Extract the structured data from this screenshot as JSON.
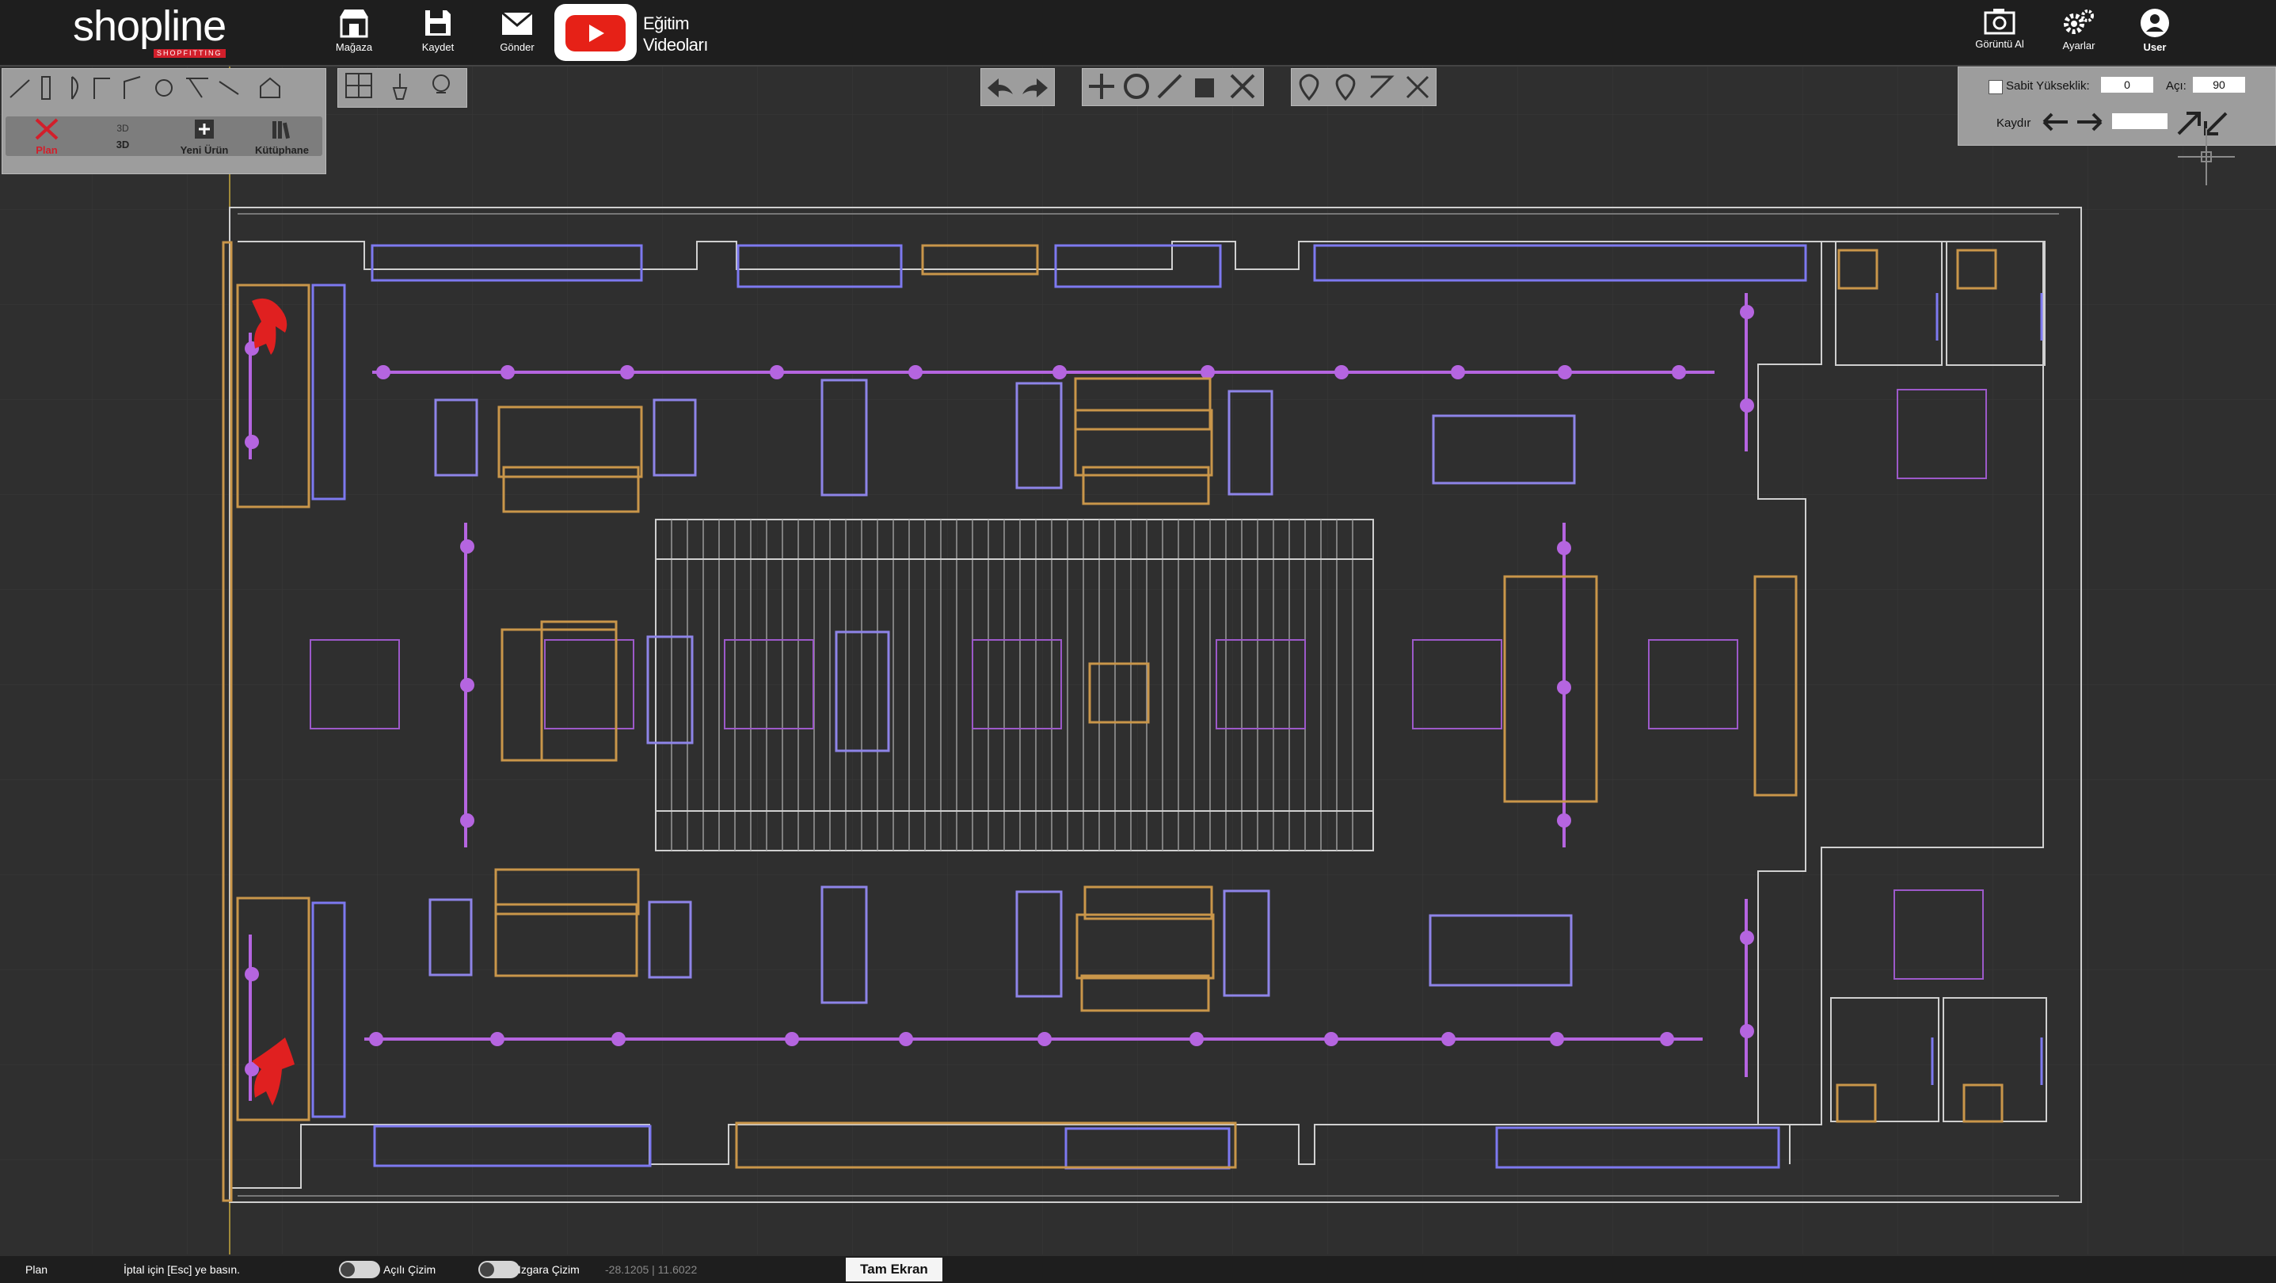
{
  "app": {
    "logo_text": "shopline",
    "logo_sub": "SHOPFITTING"
  },
  "toolbar": {
    "store_label": "Mağaza",
    "save_label": "Kaydet",
    "send_label": "Gönder",
    "tutorial_line1": "Eğitim",
    "tutorial_line2": "Videoları",
    "screenshot_label": "Görüntü Al",
    "settings_label": "Ayarlar",
    "user_label": "User"
  },
  "left_panel": {
    "plan_label": "Plan",
    "view3d_label": "3D",
    "view3d_icon_text": "3D",
    "new_product_label": "Yeni Ürün",
    "library_label": "Kütüphane"
  },
  "right_panel": {
    "fixed_height_label": "Sabit Yükseklik:",
    "fixed_height_value": "0",
    "angle_label": "Açı:",
    "angle_value": "90",
    "shift_label": "Kaydır",
    "shift_value": ""
  },
  "status_bar": {
    "mode": "Plan",
    "hint": "İptal için [Esc] ye basın.",
    "angled_drawing_label": "Açılı Çizim",
    "grid_drawing_label": "Izgara Çizim",
    "coords": "-28.1205 | 11.6022",
    "fullscreen_label": "Tam Ekran"
  },
  "colors": {
    "background": "#2f2f2f",
    "topbar": "#1e1e1e",
    "fixture_blue": "#7d79f0",
    "fixture_gold": "#c9964a",
    "light_purple": "#b565e0",
    "red": "#e02020",
    "panel": "#9d9d9d"
  }
}
